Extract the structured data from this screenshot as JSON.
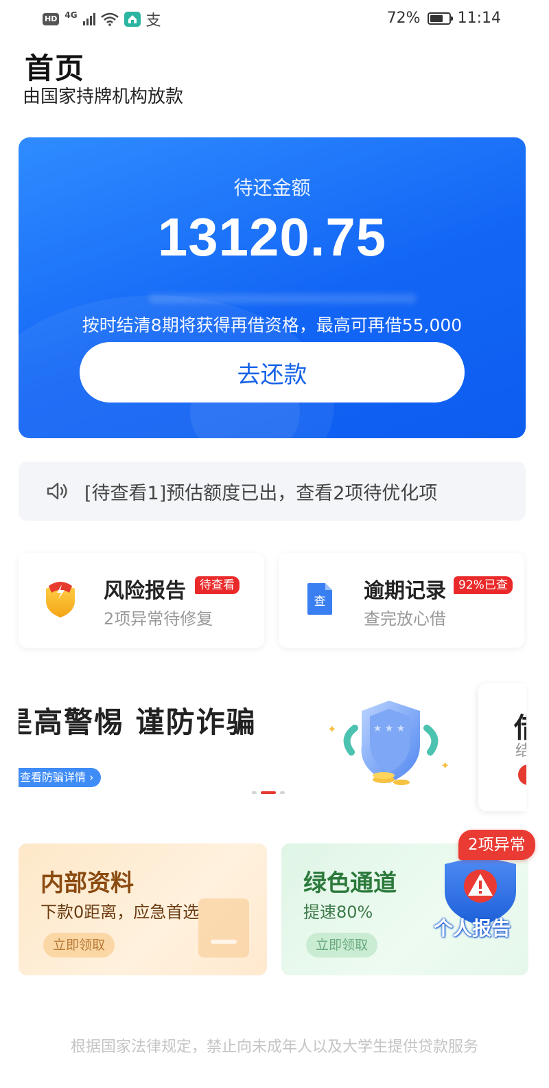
{
  "status_bar": {
    "hd": "HD",
    "network": "4G",
    "alipay": "支",
    "battery_percent": "72%",
    "battery_level": 0.72,
    "time": "11:14"
  },
  "header": {
    "title": "首页",
    "subtitle": "由国家持牌机构放款"
  },
  "hero": {
    "label": "待还金额",
    "amount": "13120.75",
    "note": "按时结清8期将获得再借资格，最高可再借55,000",
    "button": "去还款"
  },
  "notice": {
    "icon": "speaker-icon",
    "text": "[待查看1]预估额度已出，查看2项待优化项"
  },
  "cards": [
    {
      "title": "风险报告",
      "badge": "待查看",
      "subtitle": "2项异常待修复",
      "icon": "shield-lightning-icon"
    },
    {
      "title": "逾期记录",
      "badge": "92%已查",
      "subtitle": "查完放心借",
      "icon": "document-icon",
      "icon_text": "查"
    }
  ],
  "banner": {
    "title": "是高警惕 谨防诈骗",
    "link": "查看防骗详情",
    "peek_title": "借",
    "peek_sub": "结"
  },
  "promos": [
    {
      "title": "内部资料",
      "subtitle": "下款0距离，应急首选",
      "button": "立即领取"
    },
    {
      "title": "绿色通道",
      "subtitle": "提速80%",
      "button": "立即领取"
    }
  ],
  "report": {
    "badge": "2项异常",
    "label": "个人报告",
    "icon": "warning-shield-icon"
  },
  "footer": "根据国家法律规定，禁止向未成年人以及大学生提供贷款服务",
  "colors": {
    "primary_blue": "#1366f5",
    "badge_red": "#ea2a2a",
    "notice_bg": "#f3f5f8"
  }
}
